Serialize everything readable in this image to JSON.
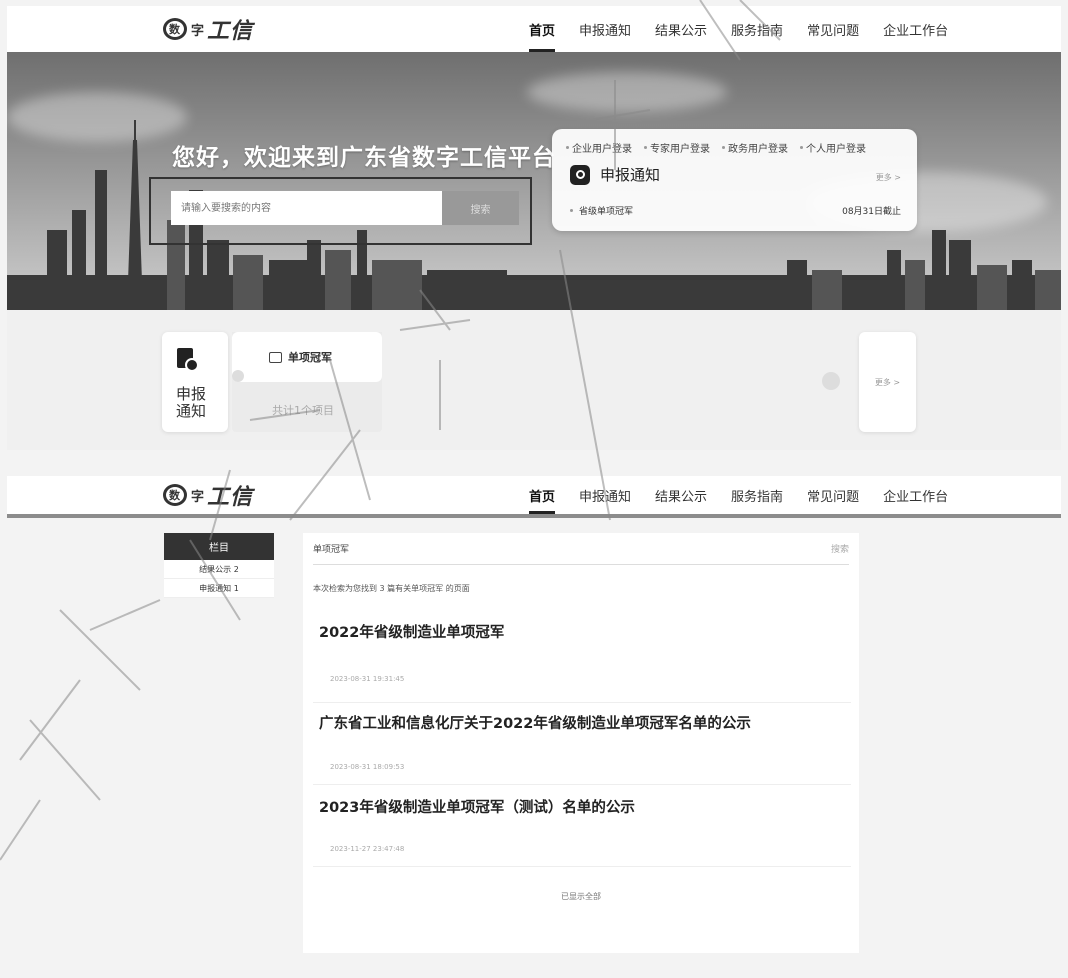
{
  "header": {
    "logo_text": "工信",
    "logo_mark": "数",
    "nav": [
      {
        "label": "首页",
        "active": true
      },
      {
        "label": "申报通知",
        "active": false
      },
      {
        "label": "结果公示",
        "active": false
      },
      {
        "label": "服务指南",
        "active": false
      },
      {
        "label": "常见问题",
        "active": false
      },
      {
        "label": "企业工作台",
        "active": false
      }
    ]
  },
  "banner": {
    "welcome": "您好，欢迎来到广东省数字工信平台",
    "search_placeholder": "请输入要搜索的内容",
    "search_button": "搜索"
  },
  "login_card": {
    "tabs": [
      "企业用户登录",
      "专家用户登录",
      "政务用户登录",
      "个人用户登录"
    ],
    "section_title": "申报通知",
    "more": "更多 >",
    "notice_item": {
      "title": "省级单项冠军",
      "deadline": "08月31日截止"
    }
  },
  "notice_section": {
    "side_label": "申报\n通知",
    "card_title": "单项冠军",
    "card_count": "共计1个项目",
    "more": "更多 >"
  },
  "results": {
    "sidebar": {
      "heading": "栏目",
      "items": [
        "结果公示 2",
        "申报通知 1"
      ]
    },
    "header_title": "单项冠军",
    "header_search": "搜索",
    "summary": "本次检索为您找到 3 篇有关单项冠军 的页面",
    "items": [
      {
        "title": "2022年省级制造业单项冠军",
        "date": "2023-08-31 19:31:45"
      },
      {
        "title": "广东省工业和信息化厅关于2022年省级制造业单项冠军名单的公示",
        "date": "2023-08-31 18:09:53"
      },
      {
        "title": "2023年省级制造业单项冠军（测试）名单的公示",
        "date": "2023-11-27 23:47:48"
      }
    ],
    "end_text": "已显示全部"
  },
  "colors": {
    "accent": "#222222",
    "nav_underline": "#222222",
    "button_gray": "#999999"
  }
}
